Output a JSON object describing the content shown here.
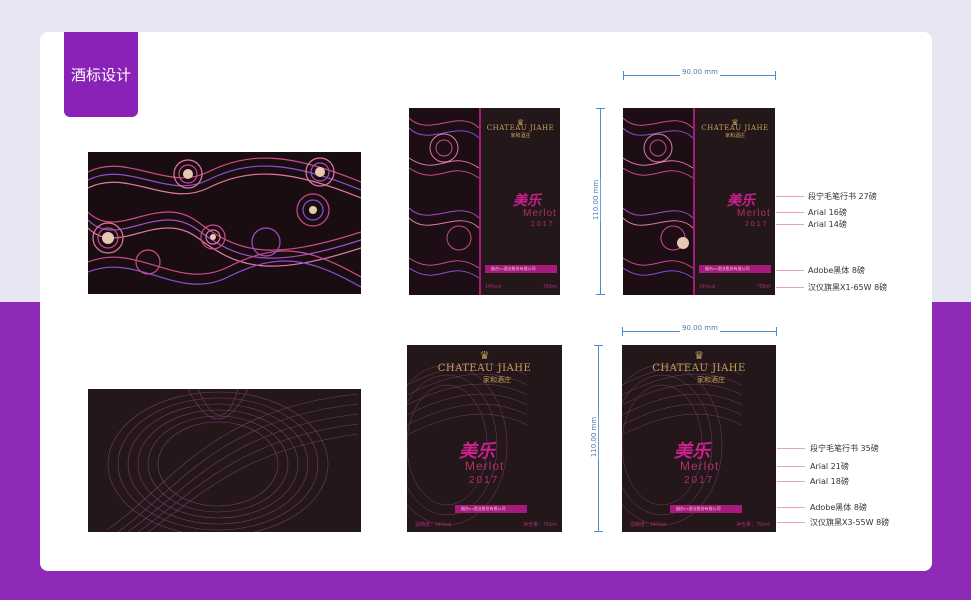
{
  "page": {
    "title": "酒标设计"
  },
  "colors": {
    "accent_purple": "#8a22b8",
    "label_bg": "#231719",
    "gold": "#c7a15b",
    "magenta": "#c8208c"
  },
  "label": {
    "brand_en": "CHATEAU JIAHE",
    "brand_cn": "家和酒庄",
    "name_cn": "美乐",
    "variety": "Merlot",
    "year": "2017",
    "company": "烟台××酒业股份有限公司",
    "abv": "14%vol",
    "volume": "750ml",
    "abv_label": "酒精度：14%vol",
    "volume_label": "净含量：750ml"
  },
  "dims": {
    "width_top": "90.00 mm",
    "height_top": "110.00 mm",
    "width_bottom": "90.00 mm",
    "height_bottom": "110.00 mm"
  },
  "annotations_top": [
    "段宁毛笔行书 27磅",
    "Arial 16磅",
    "Arial 14磅",
    "Adobe黑体 8磅",
    "汉仪旗黑X1-65W    8磅"
  ],
  "annotations_bottom": [
    "段宁毛笔行书 35磅",
    "Arial  21磅",
    "Arial 18磅",
    "Adobe黑体 8磅",
    "汉仪旗黑X3-55W    8磅"
  ]
}
